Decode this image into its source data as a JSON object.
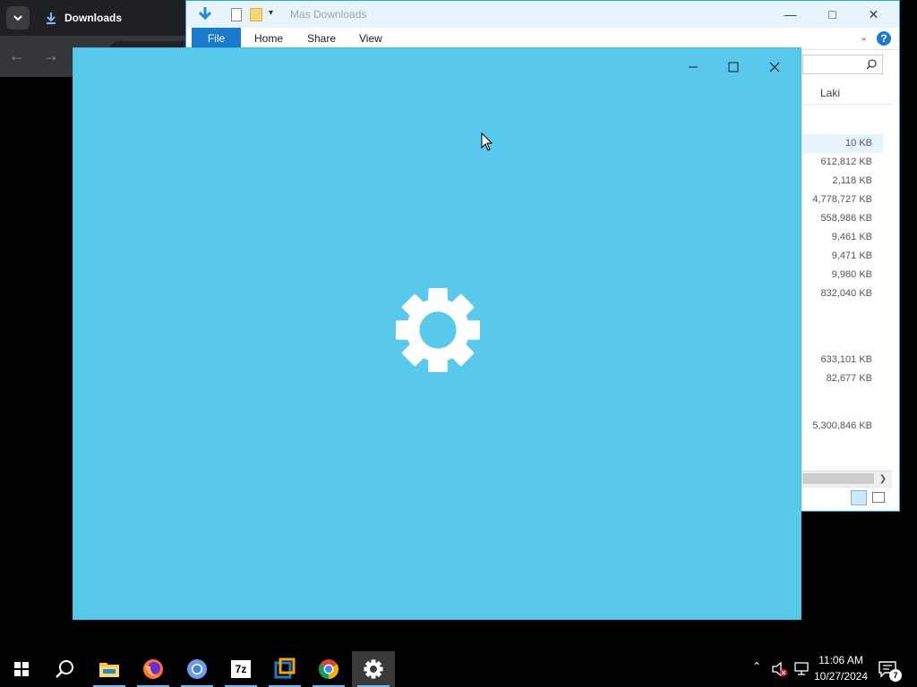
{
  "browser": {
    "tab_label": "Downloads"
  },
  "explorer": {
    "title": "Mas Downloads",
    "ribbon_tabs": [
      "File",
      "Home",
      "Share",
      "View"
    ],
    "column_header": "Laki",
    "sizes": [
      "10 KB",
      "612,812 KB",
      "2,118 KB",
      "4,778,727 KB",
      "558,986 KB",
      "9,461 KB",
      "9,471 KB",
      "9,980 KB",
      "832,040 KB",
      "633,101 KB",
      "82,677 KB",
      "5,300,846 KB"
    ],
    "help": "?"
  },
  "settings_window": {
    "bg_color": "#58c9ec",
    "icon": "gear-icon"
  },
  "taskbar": {
    "apps": [
      "start-icon",
      "search-icon",
      "file-explorer-icon",
      "firefox-icon",
      "chromium-icon",
      "7zip-icon",
      "virtualbox-icon",
      "chrome-icon",
      "settings-icon"
    ],
    "time": "11:06 AM",
    "date": "10/27/2024",
    "notification_count": "7",
    "seven_zip_label": "7z"
  }
}
